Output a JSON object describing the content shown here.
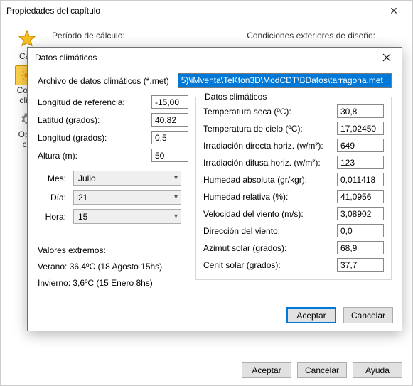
{
  "parent": {
    "title": "Propiedades del capítulo",
    "bg_label_left": "Período de cálculo:",
    "bg_label_right": "Condiciones exteriores de diseño:",
    "nav": {
      "cap": "Cap",
      "cond": "Cond\nclim",
      "opc": "Opci\ncá"
    },
    "buttons": {
      "accept": "Aceptar",
      "cancel": "Cancelar",
      "help": "Ayuda"
    }
  },
  "dialog": {
    "title": "Datos climáticos",
    "file_label": "Archivo de datos climáticos (*.met)",
    "file_value": "5)\\iMventa\\TeKton3D\\ModCDT\\BDatos\\tarragona.met",
    "ref": {
      "long_ref_label": "Longitud de referencia:",
      "long_ref": "-15,00",
      "lat_label": "Latitud (grados):",
      "lat": "40,82",
      "long_label": "Longitud (grados):",
      "long": "0,5",
      "alt_label": "Altura (m):",
      "alt": "50"
    },
    "sel": {
      "mes_label": "Mes:",
      "mes": "Julio",
      "dia_label": "Día:",
      "dia": "21",
      "hora_label": "Hora:",
      "hora": "15"
    },
    "extremes": {
      "title": "Valores extremos:",
      "summer": "Verano:  36,4ºC (18 Agosto 15hs)",
      "winter": "Invierno: 3,6ºC (15 Enero 8hs)"
    },
    "data_group": {
      "legend": "Datos climáticos",
      "rows": [
        {
          "label": "Temperatura seca (ºC):",
          "value": "30,8"
        },
        {
          "label": "Temperatura de cielo (ºC):",
          "value": "17,02450"
        },
        {
          "label": "Irradiación directa horiz. (w/m²):",
          "value": "649"
        },
        {
          "label": "Irradiación difusa horiz. (w/m²):",
          "value": "123"
        },
        {
          "label": "Humedad absoluta (gr/kgr):",
          "value": "0,011418"
        },
        {
          "label": "Humedad relativa (%):",
          "value": "41,0956"
        },
        {
          "label": "Velocidad del viento (m/s):",
          "value": "3,08902"
        },
        {
          "label": "Dirección del viento:",
          "value": "0,0"
        },
        {
          "label": "Azimut solar (grados):",
          "value": "68,9"
        },
        {
          "label": "Cenit solar (grados):",
          "value": "37,7"
        }
      ]
    },
    "buttons": {
      "accept": "Aceptar",
      "cancel": "Cancelar"
    }
  }
}
